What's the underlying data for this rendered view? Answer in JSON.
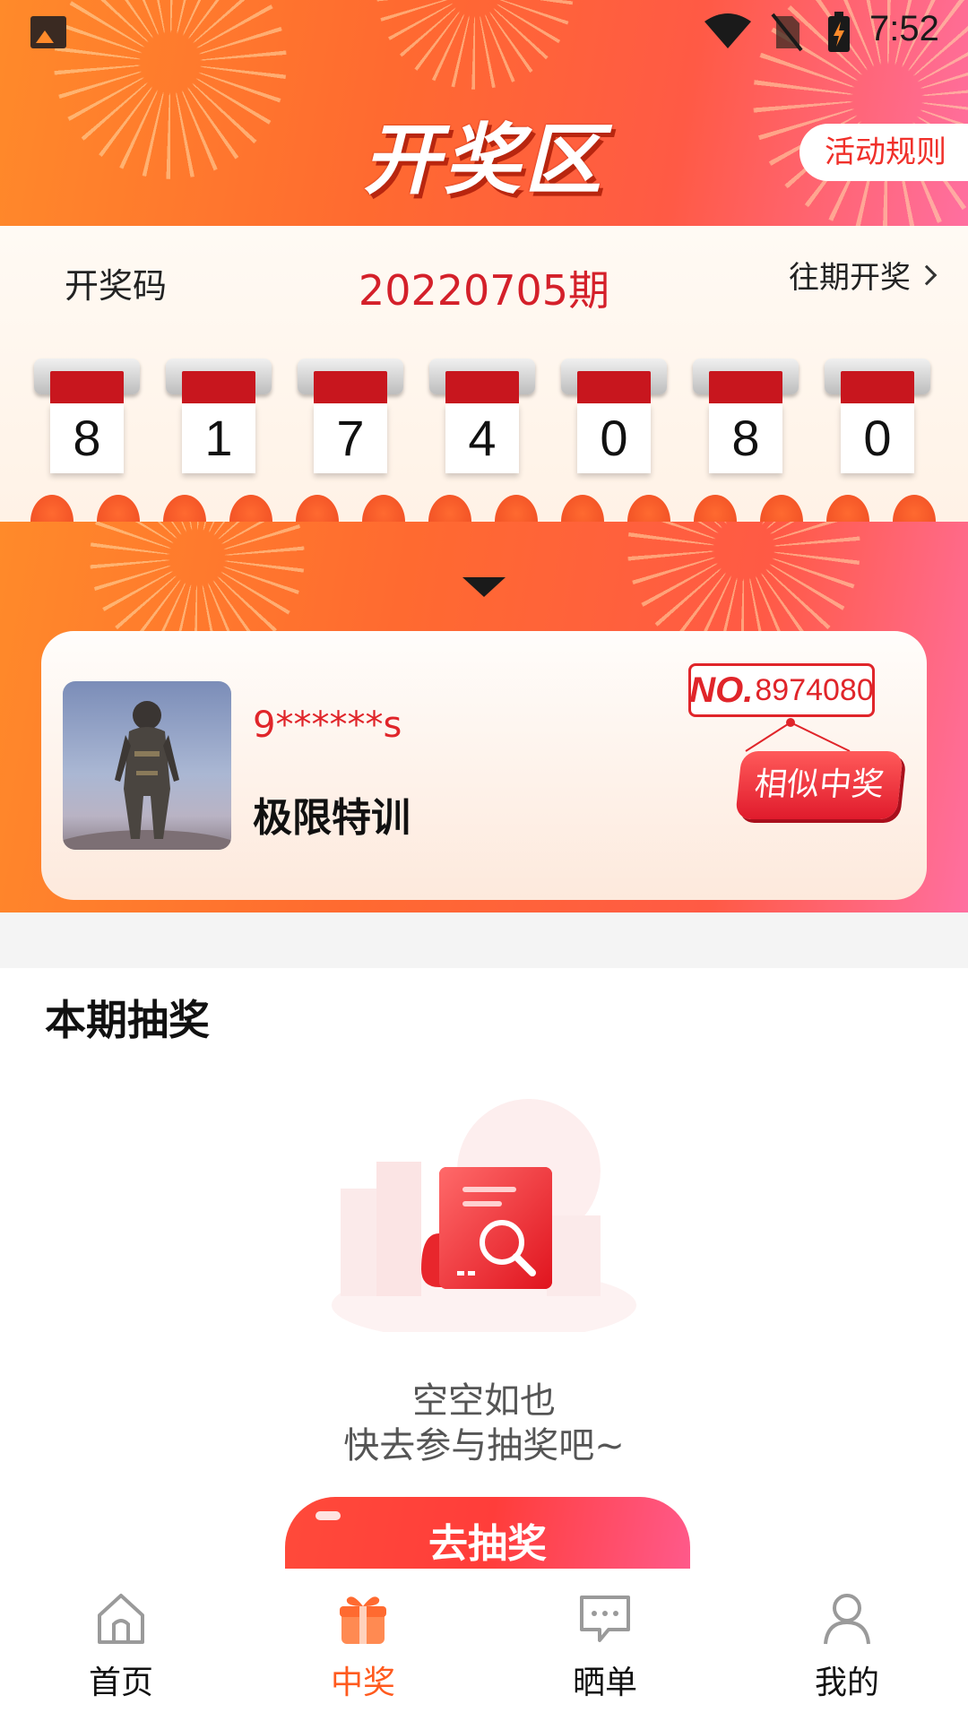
{
  "status_bar": {
    "time": "7:52"
  },
  "header": {
    "title": "开奖区",
    "rules_button": "活动规则"
  },
  "draw": {
    "code_label": "开奖码",
    "period": "20220705期",
    "history_link": "往期开奖",
    "digits": [
      "8",
      "1",
      "7",
      "4",
      "0",
      "8",
      "0"
    ]
  },
  "winner": {
    "name": "9******s",
    "prize": "极限特训",
    "no_prefix": "NO.",
    "no_number": "8974080",
    "similar_badge": "相似中奖"
  },
  "current": {
    "title": "本期抽奖",
    "empty_line1": "空空如也",
    "empty_line2": "快去参与抽奖吧~",
    "go_button": "去抽奖"
  },
  "nav": {
    "items": [
      {
        "label": "首页",
        "icon": "home-icon",
        "active": false
      },
      {
        "label": "中奖",
        "icon": "gift-icon",
        "active": true
      },
      {
        "label": "晒单",
        "icon": "message-icon",
        "active": false
      },
      {
        "label": "我的",
        "icon": "user-icon",
        "active": false
      }
    ]
  },
  "colors": {
    "accent": "#ff5a1e",
    "brand_red": "#e0252a",
    "header_orange": "#ff6a30"
  }
}
